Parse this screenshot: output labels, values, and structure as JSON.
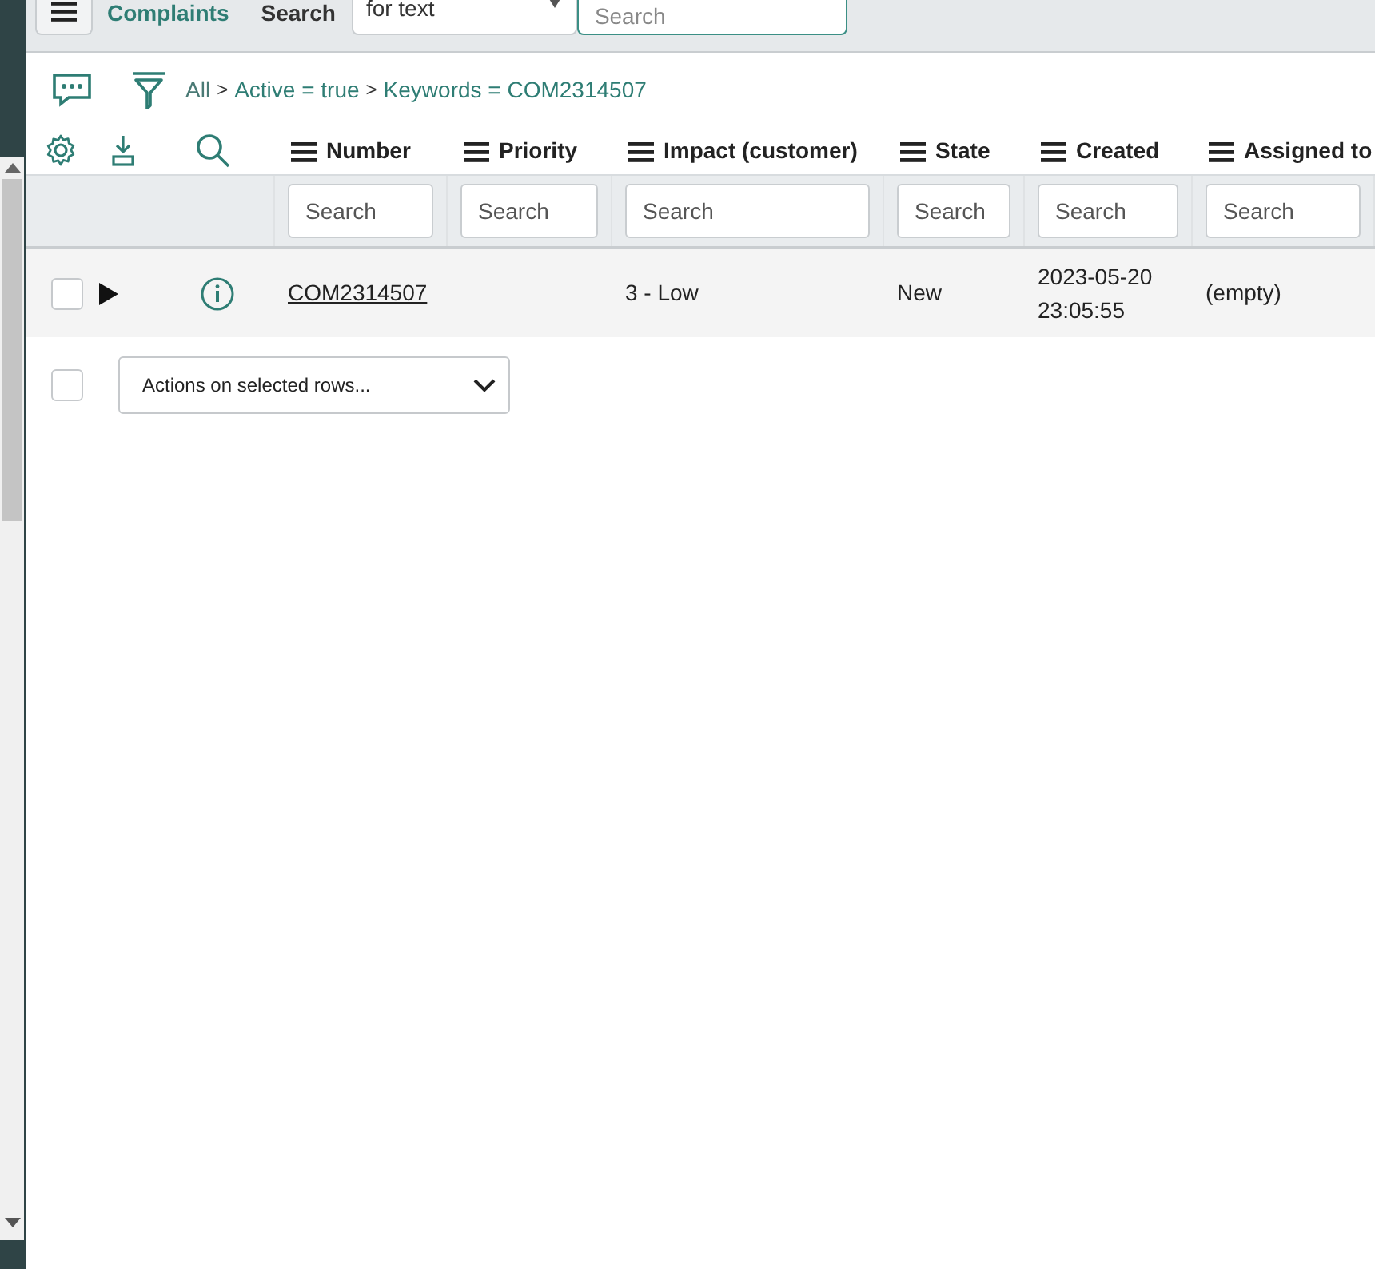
{
  "header": {
    "title": "Complaints",
    "search_label": "Search",
    "search_type": "for text",
    "search_placeholder": "Search"
  },
  "breadcrumb": {
    "separator": ">",
    "items": [
      "All",
      "Active = true",
      "Keywords = COM2314507"
    ]
  },
  "table": {
    "columns": [
      {
        "label": "Number",
        "placeholder": "Search"
      },
      {
        "label": "Priority",
        "placeholder": "Search"
      },
      {
        "label": "Impact (customer)",
        "placeholder": "Search"
      },
      {
        "label": "State",
        "placeholder": "Search"
      },
      {
        "label": "Created",
        "placeholder": "Search"
      },
      {
        "label": "Assigned to",
        "placeholder": "Search"
      }
    ],
    "rows": [
      {
        "checked": false,
        "cells": [
          "COM2314507",
          "",
          "3 - Low",
          "New",
          "2023-05-20 23:05:55",
          "(empty)"
        ]
      }
    ]
  },
  "footer": {
    "checked": false,
    "actions": "Actions on selected rows..."
  }
}
